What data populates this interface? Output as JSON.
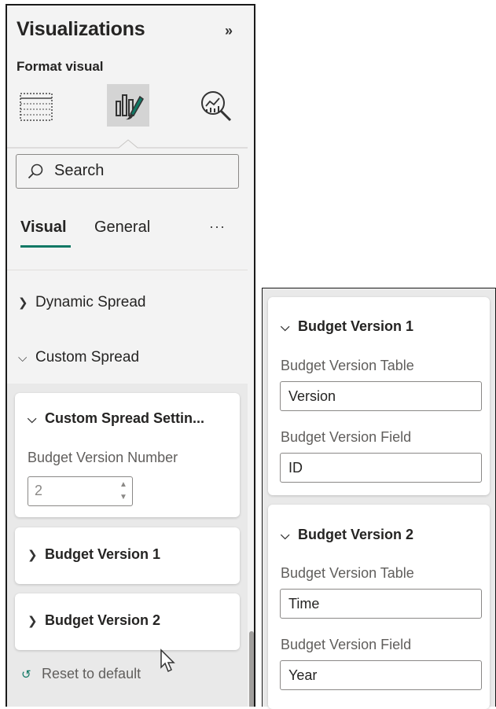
{
  "pane": {
    "title": "Visualizations",
    "collapse_icon": "»",
    "format_label": "Format visual",
    "icons": [
      "build-visual-icon",
      "format-visual-icon",
      "analytics-icon"
    ]
  },
  "search": {
    "placeholder": "Search",
    "value": ""
  },
  "tabs": [
    {
      "label": "Visual",
      "active": true
    },
    {
      "label": "General",
      "active": false
    }
  ],
  "more_label": "···",
  "sections": [
    {
      "label": "Dynamic Spread",
      "expanded": false
    },
    {
      "label": "Custom Spread",
      "expanded": true
    }
  ],
  "custom_spread_cards": [
    {
      "title": "Custom Spread Settin...",
      "expanded": true,
      "field_label": "Budget Version Number",
      "value": "2"
    },
    {
      "title": "Budget Version 1",
      "expanded": false
    },
    {
      "title": "Budget Version 2",
      "expanded": false
    }
  ],
  "reset_label": "Reset to default",
  "expanded_cards": [
    {
      "title": "Budget Version 1",
      "table_label": "Budget Version Table",
      "table_value": "Version",
      "field_label": "Budget Version Field",
      "field_value": "ID"
    },
    {
      "title": "Budget Version 2",
      "table_label": "Budget Version Table",
      "table_value": "Time",
      "field_label": "Budget Version Field",
      "field_value": "Year"
    }
  ],
  "colors": {
    "accent": "#117865",
    "panel_bg": "#f3f3f3",
    "selected_icon_bg": "#d4d4d4"
  }
}
